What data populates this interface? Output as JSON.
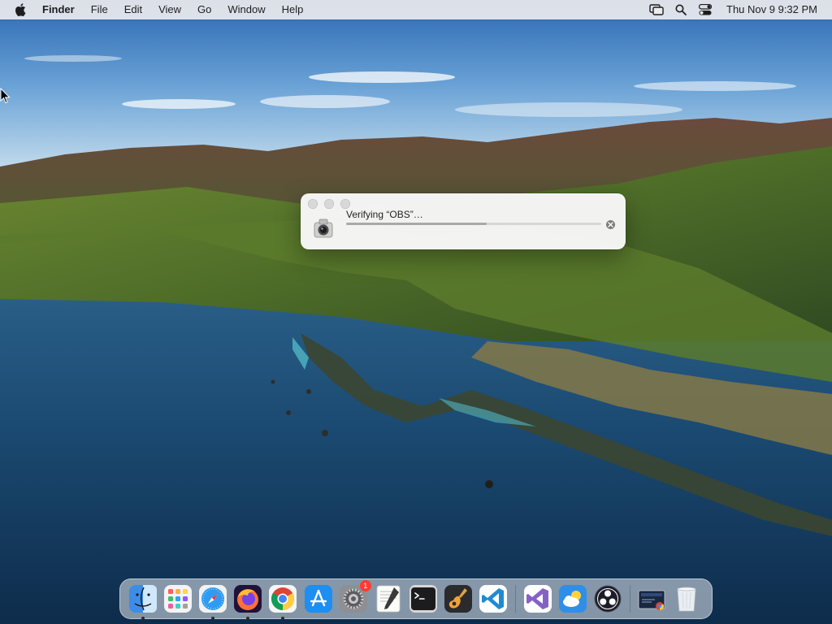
{
  "menubar": {
    "apple_icon": "apple-logo-icon",
    "app_name": "Finder",
    "menus": [
      "File",
      "Edit",
      "View",
      "Go",
      "Window",
      "Help"
    ],
    "status_icons": [
      "screen-mirroring-icon",
      "spotlight-search-icon",
      "control-center-icon"
    ],
    "clock": "Thu Nov 9  9:32 PM"
  },
  "dialog": {
    "message": "Verifying “OBS”…",
    "progress": 0.55,
    "app_icon": "obs-installer-icon",
    "cancel_icon": "cancel-x-icon",
    "window_buttons": [
      "close",
      "minimize",
      "zoom"
    ]
  },
  "dock": {
    "items": [
      {
        "id": "finder",
        "icon": "finder-icon",
        "running": true
      },
      {
        "id": "launchpad",
        "icon": "launchpad-icon",
        "running": false
      },
      {
        "id": "safari",
        "icon": "safari-icon",
        "running": true
      },
      {
        "id": "firefox",
        "icon": "firefox-icon",
        "running": true
      },
      {
        "id": "chrome",
        "icon": "chrome-icon",
        "running": true
      },
      {
        "id": "app-store",
        "icon": "app-store-icon",
        "running": false
      },
      {
        "id": "system-preferences",
        "icon": "system-preferences-icon",
        "running": false,
        "badge": "1"
      },
      {
        "id": "textedit",
        "icon": "textedit-icon",
        "running": false
      },
      {
        "id": "terminal",
        "icon": "terminal-icon",
        "running": false
      },
      {
        "id": "garageband",
        "icon": "garageband-icon",
        "running": false
      },
      {
        "id": "vscode",
        "icon": "vscode-icon",
        "running": false
      },
      {
        "id": "visual-studio",
        "icon": "visual-studio-icon",
        "running": false
      },
      {
        "id": "weather",
        "icon": "weather-icon",
        "running": false
      },
      {
        "id": "obs",
        "icon": "obs-icon",
        "running": false
      },
      {
        "id": "downloads-stack",
        "icon": "downloads-stack-icon",
        "running": false
      },
      {
        "id": "trash",
        "icon": "trash-icon",
        "running": false
      }
    ]
  },
  "colors": {
    "menubar_bg": "#ececee",
    "badge_red": "#ff3b30",
    "vscode_blue": "#1f8ad2",
    "vs_purple": "#8661c5"
  }
}
